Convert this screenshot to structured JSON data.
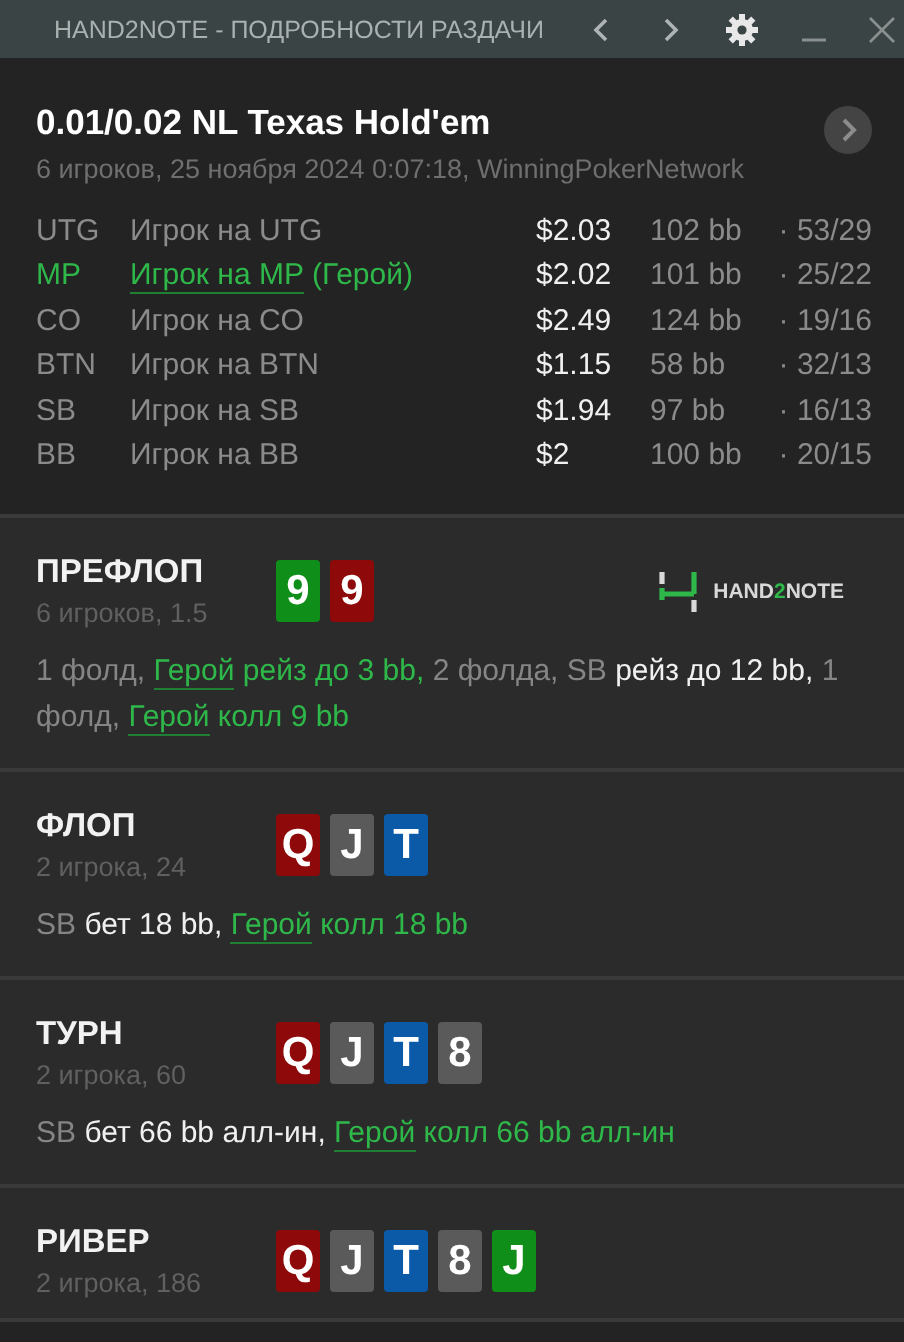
{
  "window": {
    "title": "HAND2NOTE - ПОДРОБНОСТИ РАЗДАЧИ"
  },
  "hand": {
    "title": "0.01/0.02 NL Texas Hold'em",
    "subtitle": "6 игроков, 25 ноября 2024 0:07:18, WinningPokerNetwork"
  },
  "players": [
    {
      "position": "UTG",
      "name": "Игрок на UTG",
      "hero": false,
      "stack": "$2.03",
      "bb": "102 bb",
      "stats": "· 53/29"
    },
    {
      "position": "MP",
      "name": "Игрок на MP",
      "hero": true,
      "hero_tag": "(Герой)",
      "stack": "$2.02",
      "bb": "101 bb",
      "stats": "· 25/22"
    },
    {
      "position": "CO",
      "name": "Игрок на CO",
      "hero": false,
      "stack": "$2.49",
      "bb": "124 bb",
      "stats": "· 19/16"
    },
    {
      "position": "BTN",
      "name": "Игрок на BTN",
      "hero": false,
      "stack": "$1.15",
      "bb": "58 bb",
      "stats": "· 32/13"
    },
    {
      "position": "SB",
      "name": "Игрок на SB",
      "hero": false,
      "stack": "$1.94",
      "bb": "97 bb",
      "stats": "· 16/13"
    },
    {
      "position": "BB",
      "name": "Игрок на BB",
      "hero": false,
      "stack": "$2",
      "bb": "100 bb",
      "stats": "· 20/15"
    }
  ],
  "logo": {
    "before": "HAND",
    "accent": "2",
    "after": "NOTE"
  },
  "streets": [
    {
      "name": "ПРЕФЛОП",
      "info": "6 игроков, 1.5",
      "logo": true,
      "cards": [
        {
          "rank": "9",
          "color": "#0f8f1a"
        },
        {
          "rank": "9",
          "color": "#8e0a0a"
        }
      ],
      "actions": [
        {
          "kind": "muted",
          "text": "1 фолд, "
        },
        {
          "kind": "hero",
          "text": "Герой"
        },
        {
          "kind": "green",
          "text": " рейз до 3 bb, "
        },
        {
          "kind": "muted",
          "text": "2 фолда, SB "
        },
        {
          "kind": "white",
          "text": "рейз до 12 bb, "
        },
        {
          "kind": "muted",
          "text": "1 фолд, "
        },
        {
          "kind": "hero",
          "text": "Герой"
        },
        {
          "kind": "green",
          "text": " колл 9 bb"
        }
      ]
    },
    {
      "name": "ФЛОП",
      "info": "2 игрока, 24",
      "logo": false,
      "cards": [
        {
          "rank": "Q",
          "color": "#8e0a0a"
        },
        {
          "rank": "J",
          "color": "#5a5a5a"
        },
        {
          "rank": "T",
          "color": "#0b5aa8"
        }
      ],
      "actions": [
        {
          "kind": "muted",
          "text": "SB "
        },
        {
          "kind": "white",
          "text": "бет 18 bb, "
        },
        {
          "kind": "hero",
          "text": "Герой"
        },
        {
          "kind": "green",
          "text": " колл 18 bb"
        }
      ]
    },
    {
      "name": "ТУРН",
      "info": "2 игрока, 60",
      "logo": false,
      "cards": [
        {
          "rank": "Q",
          "color": "#8e0a0a"
        },
        {
          "rank": "J",
          "color": "#5a5a5a"
        },
        {
          "rank": "T",
          "color": "#0b5aa8"
        },
        {
          "rank": "8",
          "color": "#5a5a5a"
        }
      ],
      "actions": [
        {
          "kind": "muted",
          "text": "SB "
        },
        {
          "kind": "white",
          "text": "бет 66 bb алл-ин, "
        },
        {
          "kind": "hero",
          "text": "Герой"
        },
        {
          "kind": "green",
          "text": " колл 66 bb алл-ин"
        }
      ]
    },
    {
      "name": "РИВЕР",
      "info": "2 игрока, 186",
      "logo": false,
      "cards": [
        {
          "rank": "Q",
          "color": "#8e0a0a"
        },
        {
          "rank": "J",
          "color": "#5a5a5a"
        },
        {
          "rank": "T",
          "color": "#0b5aa8"
        },
        {
          "rank": "8",
          "color": "#5a5a5a"
        },
        {
          "rank": "J",
          "color": "#0f8f1a"
        }
      ]
    }
  ]
}
